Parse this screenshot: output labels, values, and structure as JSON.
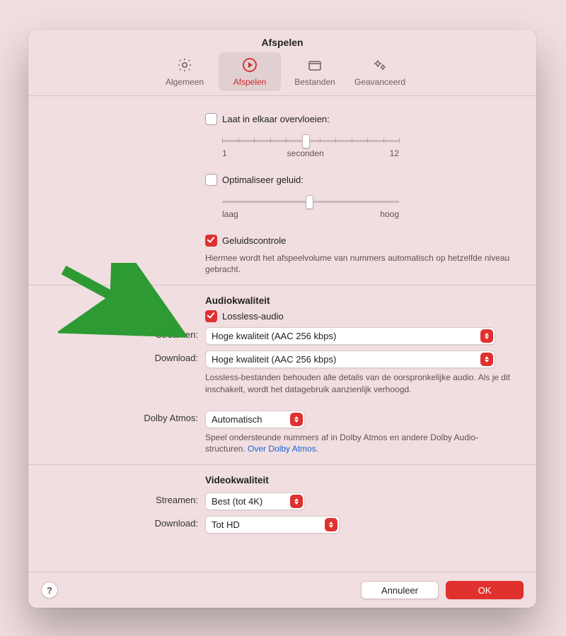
{
  "title": "Afspelen",
  "tabs": {
    "general": {
      "label": "Algemeen"
    },
    "playback": {
      "label": "Afspelen"
    },
    "files": {
      "label": "Bestanden"
    },
    "advanced": {
      "label": "Geavanceerd"
    }
  },
  "crossfade": {
    "checkbox_label": "Laat in elkaar overvloeien:",
    "min": "1",
    "unit": "seconden",
    "max": "12"
  },
  "optimize": {
    "checkbox_label": "Optimaliseer geluid:",
    "low": "laag",
    "high": "hoog"
  },
  "sound_check": {
    "checkbox_label": "Geluidscontrole",
    "helper": "Hiermee wordt het afspeelvolume van nummers automatisch op hetzelfde niveau gebracht."
  },
  "audio_quality": {
    "heading": "Audiokwaliteit",
    "lossless_label": "Lossless-audio",
    "stream_label": "Streamen:",
    "stream_value": "Hoge kwaliteit (AAC 256 kbps)",
    "download_label": "Download:",
    "download_value": "Hoge kwaliteit (AAC 256 kbps)",
    "helper": "Lossless-bestanden behouden alle details van de oorspronkelijke audio. Als je dit inschakelt, wordt het datagebruik aanzienlijk verhoogd."
  },
  "dolby": {
    "label": "Dolby Atmos:",
    "value": "Automatisch",
    "helper_pre": "Speel ondersteunde nummers af in Dolby Atmos en andere Dolby Audio-structuren. ",
    "link_text": "Over Dolby Atmos."
  },
  "video_quality": {
    "heading": "Videokwaliteit",
    "stream_label": "Streamen:",
    "stream_value": "Best (tot 4K)",
    "download_label": "Download:",
    "download_value": "Tot HD"
  },
  "footer": {
    "help": "?",
    "cancel": "Annuleer",
    "ok": "OK"
  }
}
